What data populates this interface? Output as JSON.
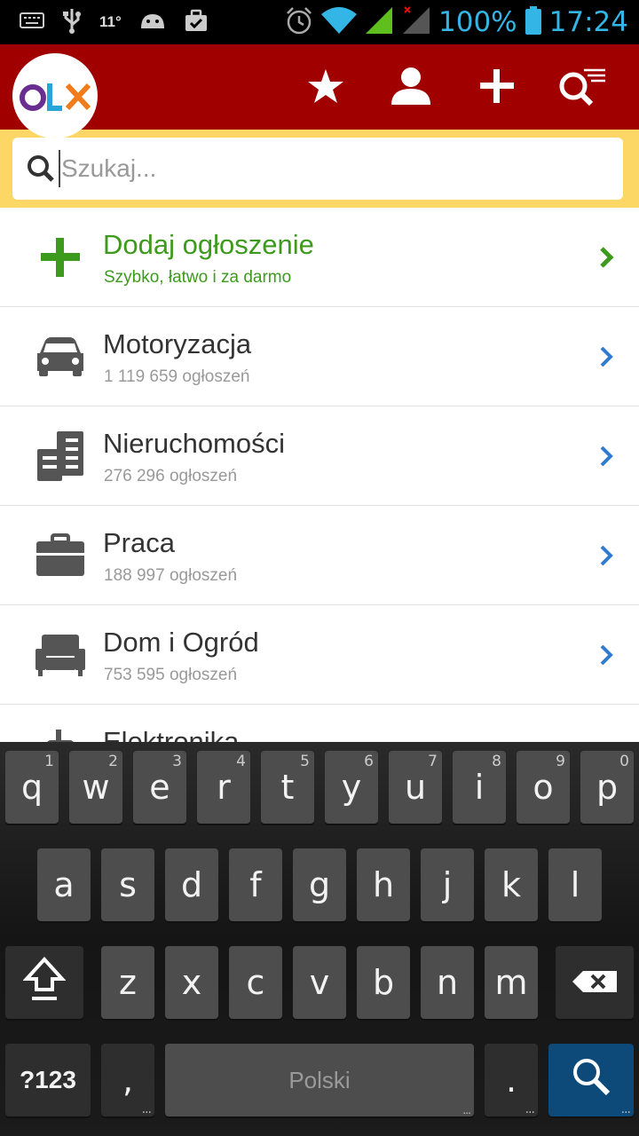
{
  "status_bar": {
    "temperature": "11°",
    "battery": "100%",
    "time": "17:24",
    "icons": [
      "keyboard-icon",
      "usb-icon",
      "android-icon",
      "briefcase-icon",
      "alarm-icon",
      "wifi-icon",
      "signal-icon",
      "signal-icon-2",
      "battery-icon"
    ]
  },
  "app_bar": {
    "logo_text": "OLX",
    "actions": [
      "star-icon",
      "user-icon",
      "plus-icon",
      "search-filter-icon"
    ],
    "color": "#a00000"
  },
  "search": {
    "placeholder": "Szukaj..."
  },
  "list": {
    "add": {
      "title": "Dodaj ogłoszenie",
      "subtitle": "Szybko, łatwo i za darmo",
      "icon": "plus-icon",
      "color": "#3c9a1c"
    },
    "categories": [
      {
        "title": "Motoryzacja",
        "count": "1 119 659 ogłoszeń",
        "icon": "car-icon"
      },
      {
        "title": "Nieruchomości",
        "count": "276 296 ogłoszeń",
        "icon": "building-icon"
      },
      {
        "title": "Praca",
        "count": "188 997 ogłoszeń",
        "icon": "briefcase-icon"
      },
      {
        "title": "Dom i Ogród",
        "count": "753 595 ogłoszeń",
        "icon": "armchair-icon"
      },
      {
        "title": "Elektronika",
        "count": "",
        "icon": "phone-icon"
      }
    ],
    "chevron_color": "#2f7bd1"
  },
  "keyboard": {
    "row1": [
      {
        "k": "q",
        "h": "1"
      },
      {
        "k": "w",
        "h": "2"
      },
      {
        "k": "e",
        "h": "3"
      },
      {
        "k": "r",
        "h": "4"
      },
      {
        "k": "t",
        "h": "5"
      },
      {
        "k": "y",
        "h": "6"
      },
      {
        "k": "u",
        "h": "7"
      },
      {
        "k": "i",
        "h": "8"
      },
      {
        "k": "o",
        "h": "9"
      },
      {
        "k": "p",
        "h": "0"
      }
    ],
    "row2": [
      "a",
      "s",
      "d",
      "f",
      "g",
      "h",
      "j",
      "k",
      "l"
    ],
    "row3": [
      "z",
      "x",
      "c",
      "v",
      "b",
      "n",
      "m"
    ],
    "symbols_label": "?123",
    "comma_label": ",",
    "space_label": "Polski",
    "period_label": ".",
    "more_dots": "..."
  }
}
